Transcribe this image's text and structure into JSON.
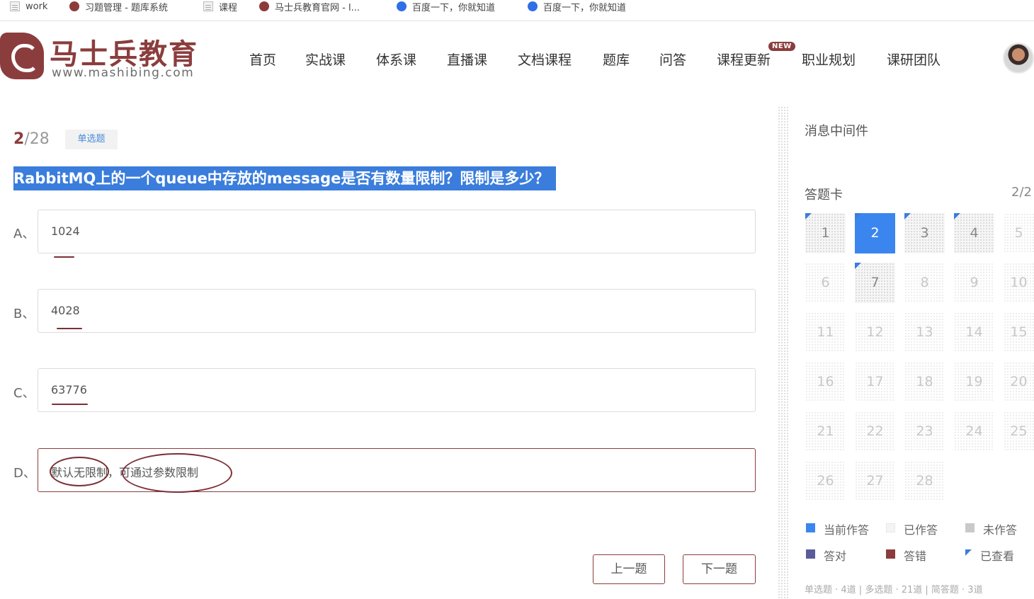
{
  "bookmarks": [
    {
      "label": "work",
      "icon": "page-icon"
    },
    {
      "label": "习题管理 - 题库系统",
      "icon": "mashibing-icon"
    },
    {
      "label": "课程",
      "icon": "page-icon"
    },
    {
      "label": "马士兵教育官网 - l...",
      "icon": "mashibing-icon"
    },
    {
      "label": "百度一下，你就知道",
      "icon": "baidu-icon"
    },
    {
      "label": "百度一下，你就知道",
      "icon": "baidu-icon"
    }
  ],
  "brand": {
    "name": "马士兵教育",
    "url": "www.mashibing.com",
    "color": "#8b3d3d"
  },
  "nav": [
    "首页",
    "实战课",
    "体系课",
    "直播课",
    "文档课程",
    "题库",
    "问答",
    "课程更新",
    "职业规划",
    "课研团队"
  ],
  "nav_badge": "NEW",
  "question": {
    "current": "2",
    "total": "/28",
    "type": "单选题",
    "title": "RabbitMQ上的一个queue中存放的message是否有数量限制？限制是多少？",
    "options": [
      {
        "letter": "A、",
        "text": "1024"
      },
      {
        "letter": "B、",
        "text": "4028"
      },
      {
        "letter": "C、",
        "text": "63776"
      },
      {
        "letter": "D、",
        "text": "默认无限制，可通过参数限制"
      }
    ]
  },
  "buttons": {
    "prev": "上一题",
    "next": "下一题"
  },
  "side": {
    "category": "消息中间件",
    "card_title": "答题卡",
    "card_count": "2/2",
    "cells": [
      "1",
      "2",
      "3",
      "4",
      "5",
      "6",
      "7",
      "8",
      "9",
      "10",
      "11",
      "12",
      "13",
      "14",
      "15",
      "16",
      "17",
      "18",
      "19",
      "20",
      "21",
      "22",
      "23",
      "24",
      "25",
      "26",
      "27",
      "28"
    ],
    "legend": {
      "current": "当前作答",
      "answered": "已作答",
      "unanswered": "未作答",
      "correct": "答对",
      "wrong": "答错",
      "viewed": "已查看"
    },
    "summary": "单选题 · 4道  |  多选题 · 21道  |  简答题 · 3道"
  },
  "colors": {
    "accent": "#3a86ee",
    "brand": "#8b3d3d",
    "correct": "#5b5a9a",
    "wrong": "#8b3d3d"
  }
}
